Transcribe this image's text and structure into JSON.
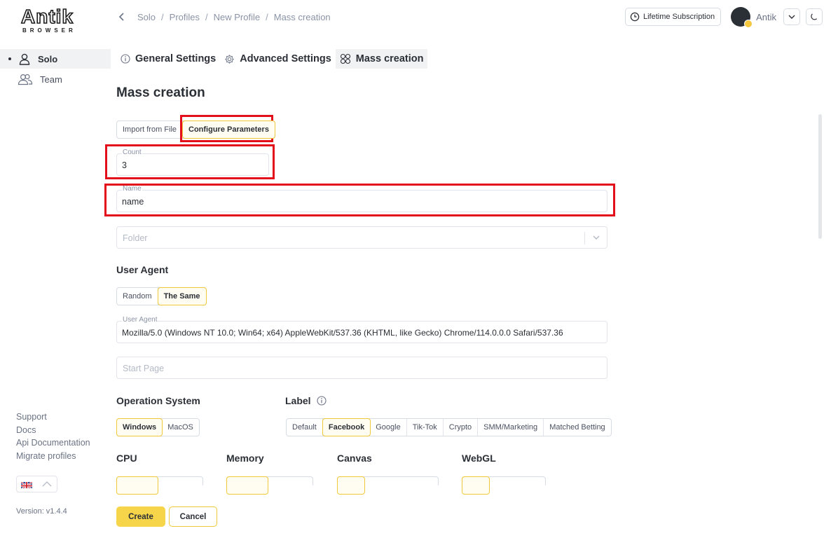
{
  "brand": {
    "name": "Antik",
    "sub": "BROWSER"
  },
  "breadcrumb": [
    "Solo",
    "Profiles",
    "New Profile",
    "Mass creation"
  ],
  "topbar": {
    "subscription_label": "Lifetime Subscription",
    "username": "Antik"
  },
  "sidebar": {
    "items": [
      {
        "label": "Solo",
        "active": true
      },
      {
        "label": "Team",
        "active": false
      }
    ],
    "links": [
      "Support",
      "Docs",
      "Api Documentation",
      "Migrate profiles"
    ],
    "version": "Version: v1.4.4"
  },
  "tabs": [
    {
      "label": "General Settings"
    },
    {
      "label": "Advanced Settings"
    },
    {
      "label": "Mass creation",
      "active": true
    }
  ],
  "page_title": "Mass creation",
  "mode": {
    "options": [
      "Import from File",
      "Configure Parameters"
    ],
    "selected": "Configure Parameters"
  },
  "count": {
    "label": "Count",
    "value": "3"
  },
  "name": {
    "label": "Name",
    "value": "name"
  },
  "folder": {
    "placeholder": "Folder"
  },
  "user_agent": {
    "title": "User Agent",
    "options": [
      "Random",
      "The Same"
    ],
    "selected": "The Same",
    "field_label": "User Agent",
    "value": "Mozilla/5.0 (Windows NT 10.0; Win64; x64) AppleWebKit/537.36 (KHTML, like Gecko) Chrome/114.0.0.0 Safari/537.36"
  },
  "start_page": {
    "placeholder": "Start Page"
  },
  "os": {
    "title": "Operation System",
    "options": [
      "Windows",
      "MacOS"
    ],
    "selected": "Windows"
  },
  "label": {
    "title": "Label",
    "options": [
      "Default",
      "Facebook",
      "Google",
      "Tik-Tok",
      "Crypto",
      "SMM/Marketing",
      "Matched Betting"
    ],
    "selected": "Facebook"
  },
  "lower_sections": {
    "cpu": "CPU",
    "memory": "Memory",
    "canvas": "Canvas",
    "webgl": "WebGL"
  },
  "actions": {
    "create": "Create",
    "cancel": "Cancel"
  },
  "colors": {
    "accent": "#f7d54a",
    "annotation": "#e3101b",
    "text": "#2b2f36"
  }
}
